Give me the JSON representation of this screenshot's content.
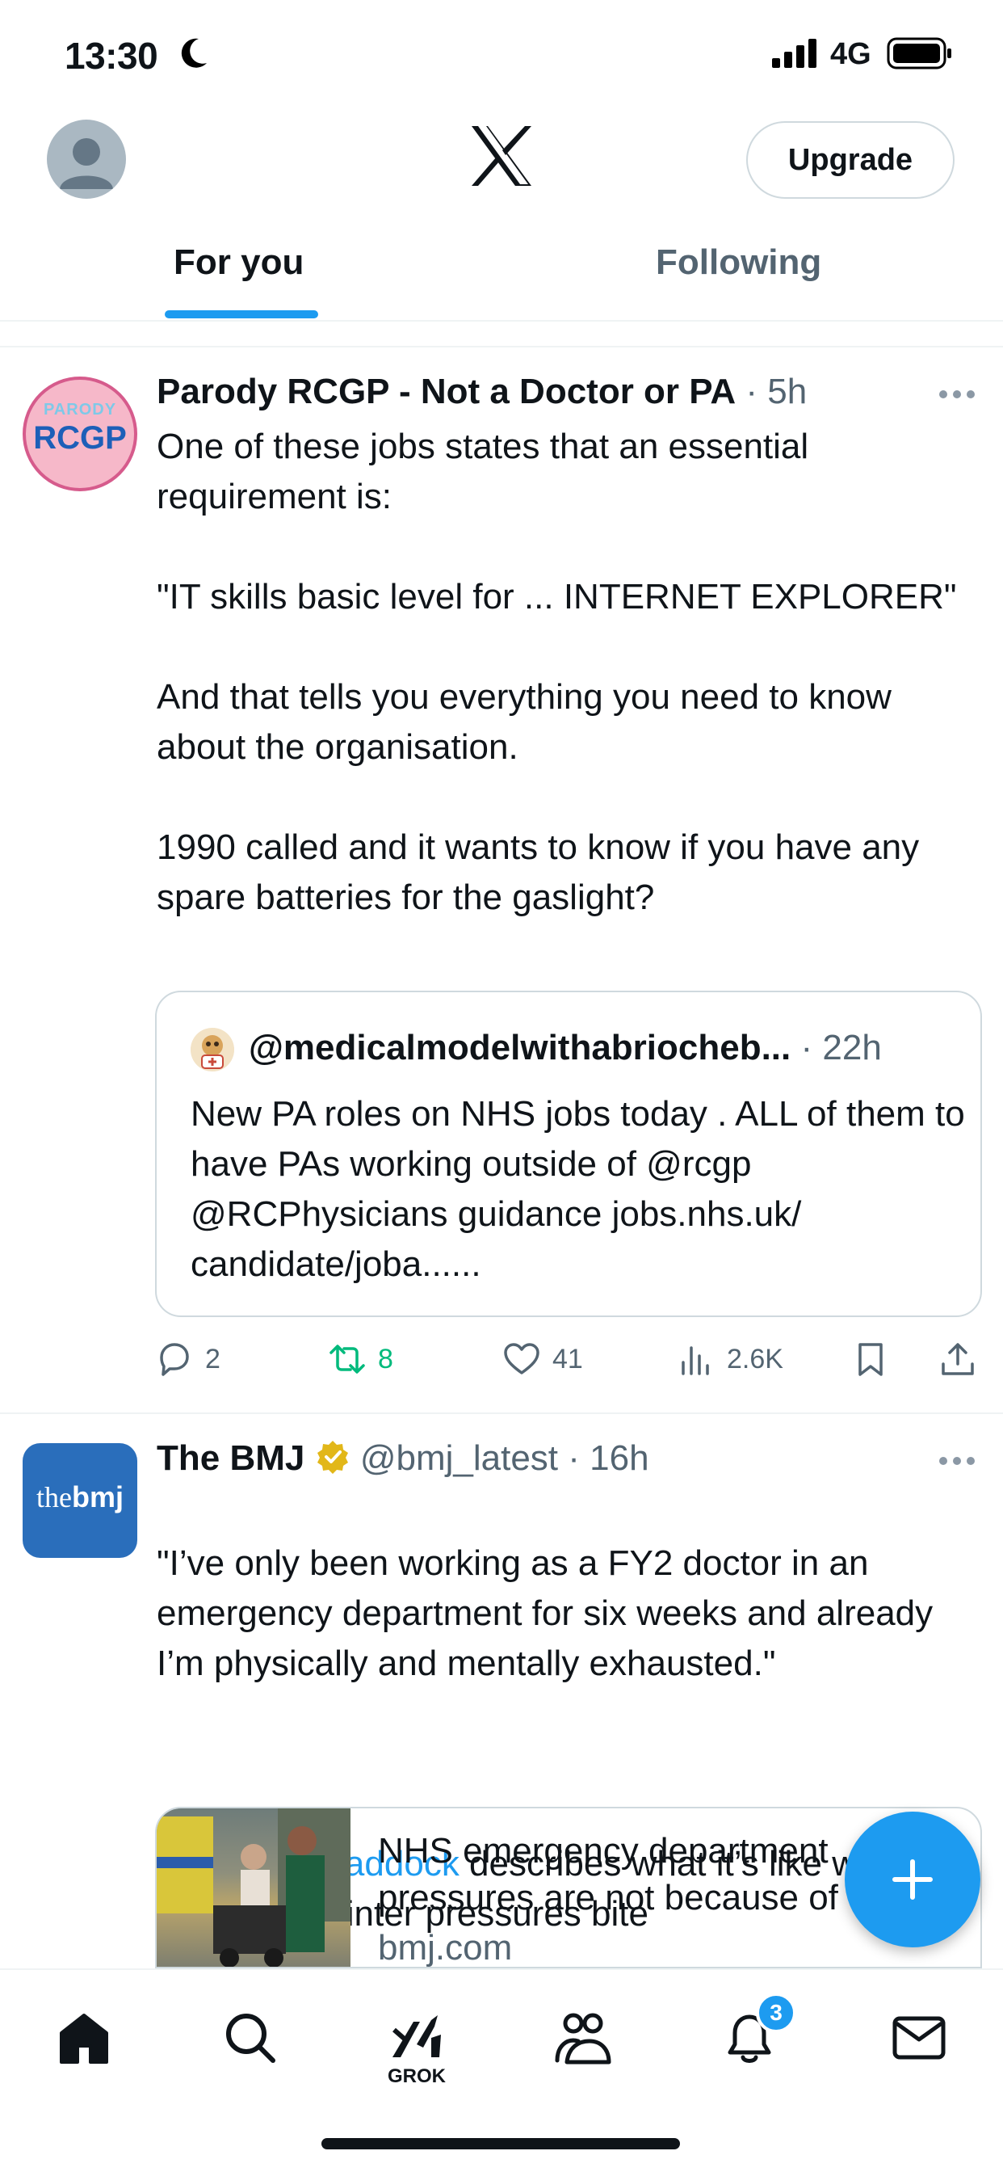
{
  "status_bar": {
    "time": "13:30",
    "network": "4G",
    "icons": [
      "moon-icon",
      "signal-icon",
      "battery-icon"
    ]
  },
  "header": {
    "logo": "x-logo",
    "upgrade_label": "Upgrade"
  },
  "tabs": [
    {
      "label": "For you",
      "active": true
    },
    {
      "label": "Following",
      "active": false
    }
  ],
  "posts": [
    {
      "avatar_text_top": "PARODY",
      "avatar_text_main": "RCGP",
      "name": "Parody RCGP - Not a Doctor or PA",
      "time": "5h",
      "body": "One of these jobs states that an essential requirement is:\n\n\"IT skills basic level for ... INTERNET EXPLORER\"\n\nAnd that tells you everything you need to know about the organisation.\n\n1990 called and it wants to know if you have any spare batteries for the gaslight?",
      "quote": {
        "handle": "@medicalmodelwithabriocheb...",
        "time": "22h",
        "body": "New PA roles on NHS jobs today . ALL of them to have PAs working outside of @rcgp @RCPhysicians guidance jobs.nhs.uk/ candidate/joba......"
      },
      "actions": {
        "replies": "2",
        "reposts": "8",
        "likes": "41",
        "views": "2.6K"
      }
    },
    {
      "avatar_text_light": "the",
      "avatar_text_bold": "bmj",
      "name": "The BMJ",
      "verified": true,
      "handle": "@bmj_latest",
      "time": "16h",
      "body_quote": "\"I’ve only been working as a FY2 doctor in an emergency department for six weeks and already I’m physically and mentally exhausted.\"",
      "mention": "@DrLukeCraddock",
      "body_rest": " describes what it’s like working in A&E as winter pressures bite",
      "card": {
        "title": "NHS emergency department pressures are not because of",
        "domain": "bmj.com"
      }
    }
  ],
  "bottom_nav": {
    "items": [
      "home-icon",
      "search-icon",
      "grok-icon",
      "communities-icon",
      "notifications-icon",
      "messages-icon"
    ],
    "grok_label": "GROK",
    "notification_count": "3"
  },
  "colors": {
    "accent": "#1d9bf0",
    "text": "#0f1419",
    "secondary": "#536471",
    "repost_active": "#00ba7c",
    "verified_gold": "#e2b719"
  }
}
